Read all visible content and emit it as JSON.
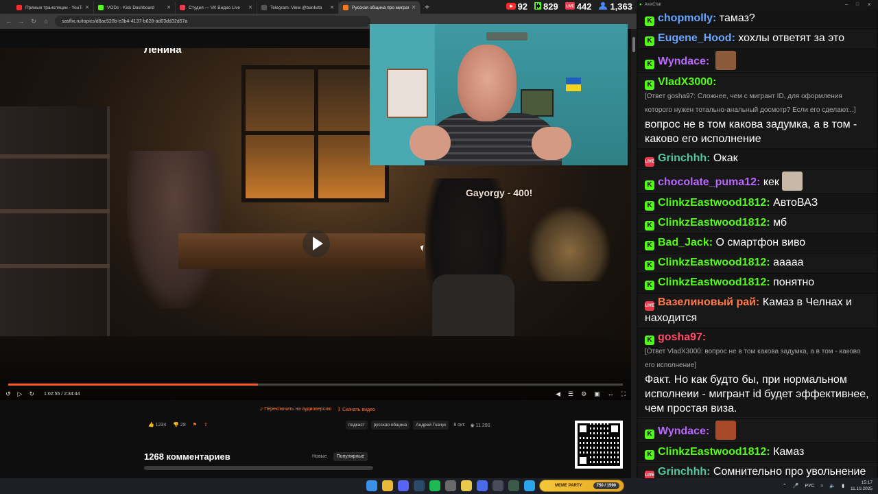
{
  "browser": {
    "tabs": [
      {
        "label": "Прямые трансляции - YouTube",
        "color": "#ff2a2a"
      },
      {
        "label": "VODs - Kick Dashboard",
        "color": "#53fc18"
      },
      {
        "label": "Студия — VK Видео Live",
        "color": "#e8394b"
      },
      {
        "label": "Telegram: View @banksta",
        "color": "#555555"
      },
      {
        "label": "Русская община про мигрант",
        "color": "#ff7a1a",
        "active": true
      }
    ],
    "new_tab": "+",
    "url": "sasflix.ru/topics/d8ac520b-e3b4-4137-b628-ad03dd32d57a"
  },
  "stats": {
    "youtube": "92",
    "kick": "829",
    "vk": "442",
    "viewers": "1,363",
    "youtube_color": "#ff2a2a",
    "kick_color": "#53fc18",
    "vk_color": "#e8394b"
  },
  "video": {
    "title": "Ленина",
    "overlay_text": "Gayorgy - 400!",
    "current_time": "1:02:55",
    "duration": "2:34:44",
    "progress_fraction": 0.406,
    "accent": "#ff5a1f"
  },
  "below": {
    "audio_link": "Переключить на аудиоверсию",
    "download_link": "Скачать видео",
    "likes": "1234",
    "dislikes": "28",
    "tags": [
      "подкаст",
      "русская община",
      "Андрей Ткачук"
    ],
    "date": "8 окт.",
    "views": "11 290",
    "comments_title": "1268 комментариев",
    "sort_new": "Новые",
    "sort_popular": "Популярные"
  },
  "chat": {
    "window_title": "AxelChat",
    "messages": [
      {
        "platform": "kick",
        "user": "chopmolly",
        "color": "#6aa6ff",
        "text": "тамаз?"
      },
      {
        "platform": "kick",
        "user": "Eugene_Hood",
        "color": "#6aa6ff",
        "text": "хохлы ответят за это"
      },
      {
        "platform": "kick",
        "user": "Wyndace",
        "color": "#b967ff",
        "text": "",
        "emote": "#8a5a3a"
      },
      {
        "platform": "kick",
        "user": "VladX3000",
        "color": "#53fc18",
        "reply": "[Ответ gosha97: Сложнее, чем с мигрант ID, для оформления которого нужен тотально-анальный досмотр? Если его сделают...]",
        "text": "вопрос не в том какова задумка, а в том - каково его исполнение"
      },
      {
        "platform": "vk",
        "user": "Grinchhh",
        "color": "#53c7a2",
        "text": "Окак"
      },
      {
        "platform": "kick",
        "user": "chocolate_puma12",
        "color": "#b967ff",
        "text": "кек",
        "emote": "#c8b8a8"
      },
      {
        "platform": "kick",
        "user": "ClinkzEastwood1812",
        "color": "#53fc18",
        "text": "АвтоВАЗ"
      },
      {
        "platform": "kick",
        "user": "ClinkzEastwood1812",
        "color": "#53fc18",
        "text": "мб"
      },
      {
        "platform": "kick",
        "user": "Bad_Jack",
        "color": "#53fc18",
        "text": "О смартфон виво"
      },
      {
        "platform": "kick",
        "user": "ClinkzEastwood1812",
        "color": "#53fc18",
        "text": "ааааа"
      },
      {
        "platform": "kick",
        "user": "ClinkzEastwood1812",
        "color": "#53fc18",
        "text": "понятно"
      },
      {
        "platform": "vk",
        "user": "Вазелиновый рай",
        "color": "#ff7a4a",
        "text": "Камаз в Челнах и находится"
      },
      {
        "platform": "kick",
        "user": "gosha97",
        "color": "#ff4a6a",
        "reply": "[Ответ VladX3000: вопрос не в том какова задумка, а в том - каково его исполнение]",
        "text": "Факт. Но как будто бы, при нормальном исполнеии - мигрант id будет эффективнее, чем простая виза."
      },
      {
        "platform": "kick",
        "user": "Wyndace",
        "color": "#b967ff",
        "text": "",
        "emote": "#a84a2a"
      },
      {
        "platform": "kick",
        "user": "ClinkzEastwood1812",
        "color": "#53fc18",
        "text": "Камаз"
      },
      {
        "platform": "vk",
        "user": "Grinchhh",
        "color": "#53c7a2",
        "text": "Сомнительно про увольнение"
      }
    ]
  },
  "taskbar": {
    "meme_label": "MEME PARTY",
    "meme_count": "750 / 1590",
    "lang": "РУС",
    "time": "15:17",
    "date": "11.10.2025"
  }
}
